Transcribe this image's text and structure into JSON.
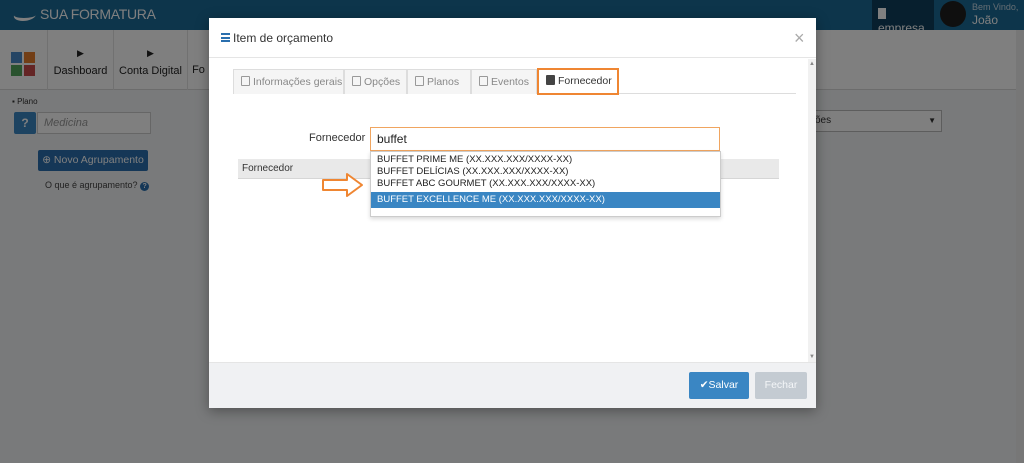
{
  "header": {
    "logo_text": "SUA FORMATURA",
    "company_label": "empresa",
    "welcome": "Bem Vindo,",
    "user_name": "João"
  },
  "nav": {
    "items": [
      {
        "label": "Dashboard"
      },
      {
        "label": "Conta Digital"
      },
      {
        "label": "Fo"
      }
    ]
  },
  "sidebar": {
    "plano_label": "Plano",
    "plano_placeholder": "Medicina",
    "new_group_button": "Novo Agrupamento",
    "help_link": "O que é agrupamento?",
    "right_select_partial": "ões"
  },
  "modal": {
    "title": "Item de orçamento",
    "close_glyph": "×",
    "tabs": [
      {
        "label": "Informações gerais",
        "icon": "document-icon",
        "active": false
      },
      {
        "label": "Opções",
        "icon": "list-icon",
        "active": false
      },
      {
        "label": "Planos",
        "icon": "table-icon",
        "active": false
      },
      {
        "label": "Eventos",
        "icon": "calendar-icon",
        "active": false
      },
      {
        "label": "Fornecedor",
        "icon": "building-icon",
        "active": true
      }
    ],
    "supplier_label": "Fornecedor",
    "supplier_value": "buffet",
    "grid_header": "Fornecedor",
    "suggestions": [
      "BUFFET PRIME ME (XX.XXX.XXX/XXXX-XX)",
      "BUFFET DELÍCIAS (XX.XXX.XXX/XXXX-XX)",
      "BUFFET ABC GOURMET (XX.XXX.XXX/XXXX-XX)",
      "BUFFET EXCELLENCE ME (XX.XXX.XXX/XXXX-XX)"
    ],
    "selected_suggestion_index": 3,
    "save_button": "Salvar",
    "close_button": "Fechar"
  },
  "colors": {
    "topbar": "#1b6b96",
    "primary": "#3a86c3",
    "highlight": "#ef8632"
  }
}
